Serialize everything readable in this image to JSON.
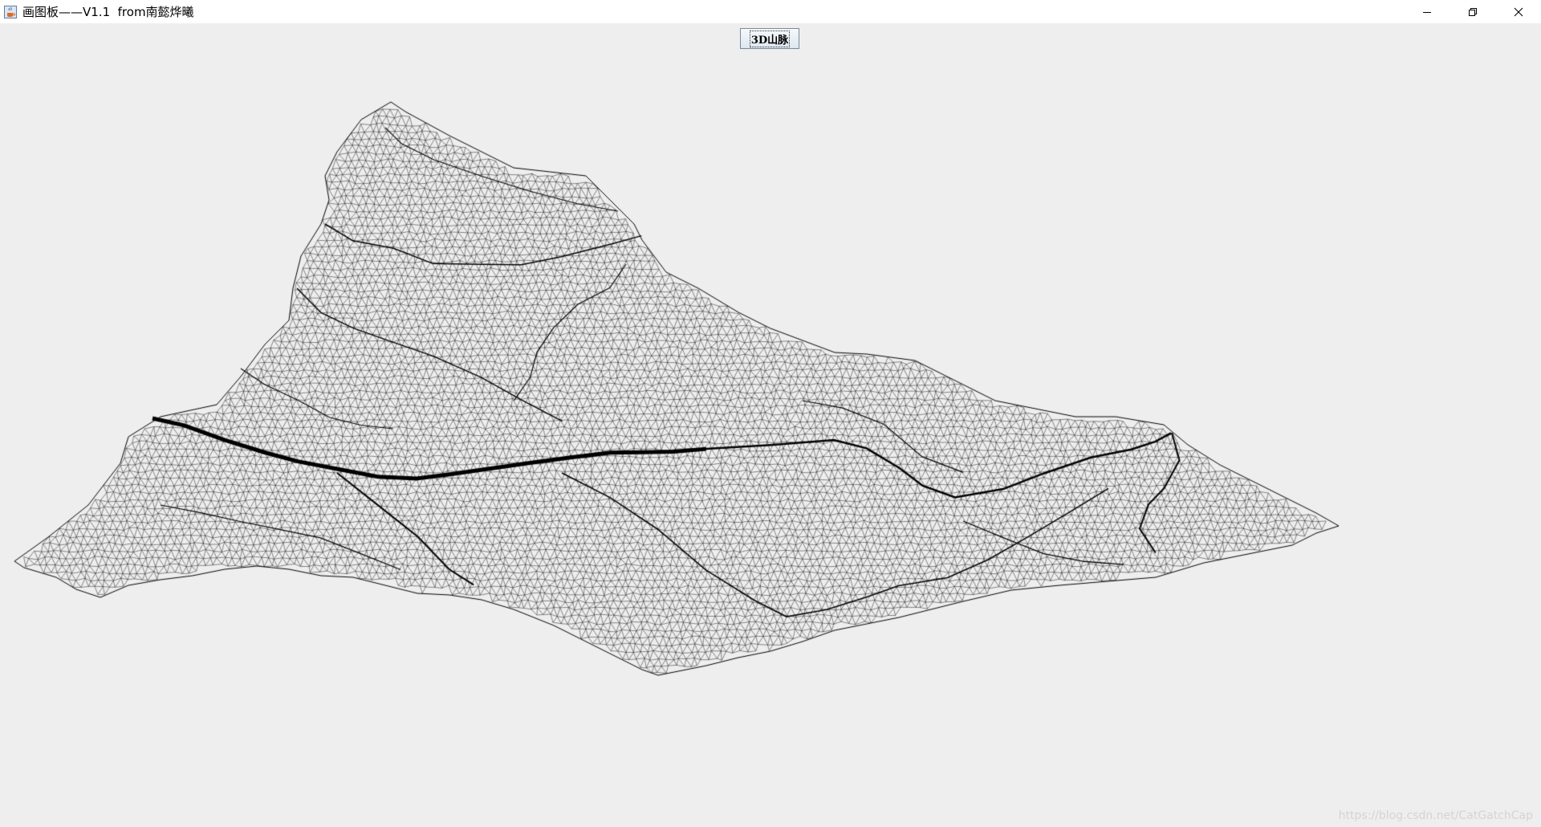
{
  "window": {
    "title": "画图板——V1.1  from南懿烨曦",
    "app_icon": "java-cup-icon",
    "controls": {
      "minimize": "minimize-icon",
      "restore": "restore-icon",
      "close": "close-icon"
    }
  },
  "toolbar": {
    "mountain_button_label": "3D山脉"
  },
  "canvas": {
    "content": "3d-mountain-wireframe",
    "stroke_color": "#000000",
    "background_color": "#eeeeee"
  },
  "watermark": {
    "text": "https://blog.csdn.net/CatGatchCap"
  }
}
